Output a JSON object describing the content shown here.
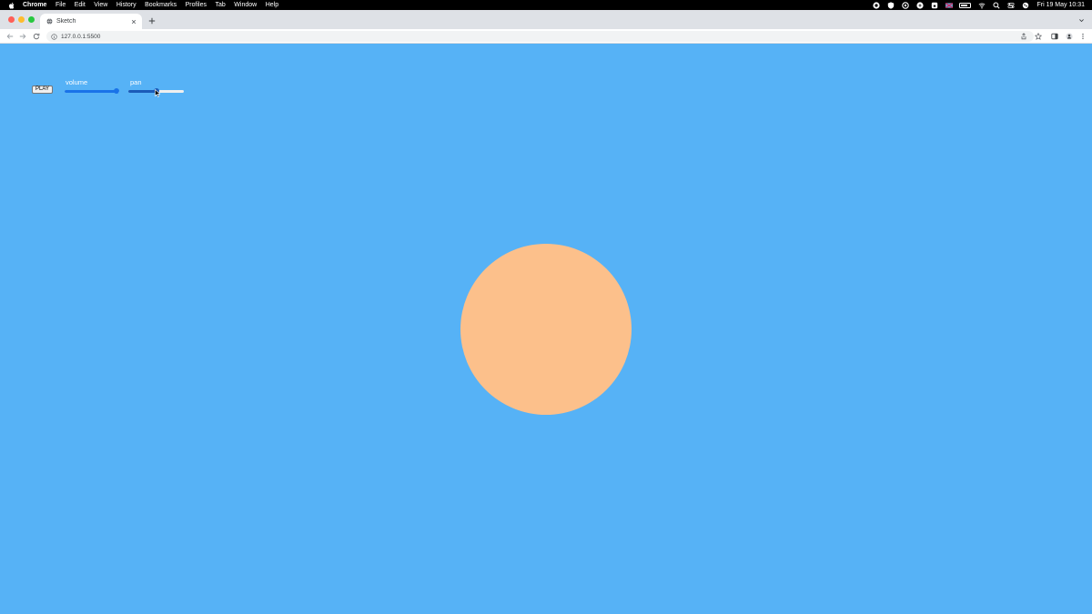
{
  "menubar": {
    "app_name": "Chrome",
    "items": [
      "File",
      "Edit",
      "View",
      "History",
      "Bookmarks",
      "Profiles",
      "Tab",
      "Window",
      "Help"
    ],
    "clock": "Fri 19 May  10:31"
  },
  "browser": {
    "tab_title": "Sketch",
    "url": "127.0.0.1:5500"
  },
  "sketch": {
    "play_label": "PLAY",
    "volume_label": "volume",
    "pan_label": "pan",
    "volume_level": 0.95,
    "pan_level": 0.5,
    "background_color": "#56b2f6",
    "circle_color": "#fcc08b"
  }
}
